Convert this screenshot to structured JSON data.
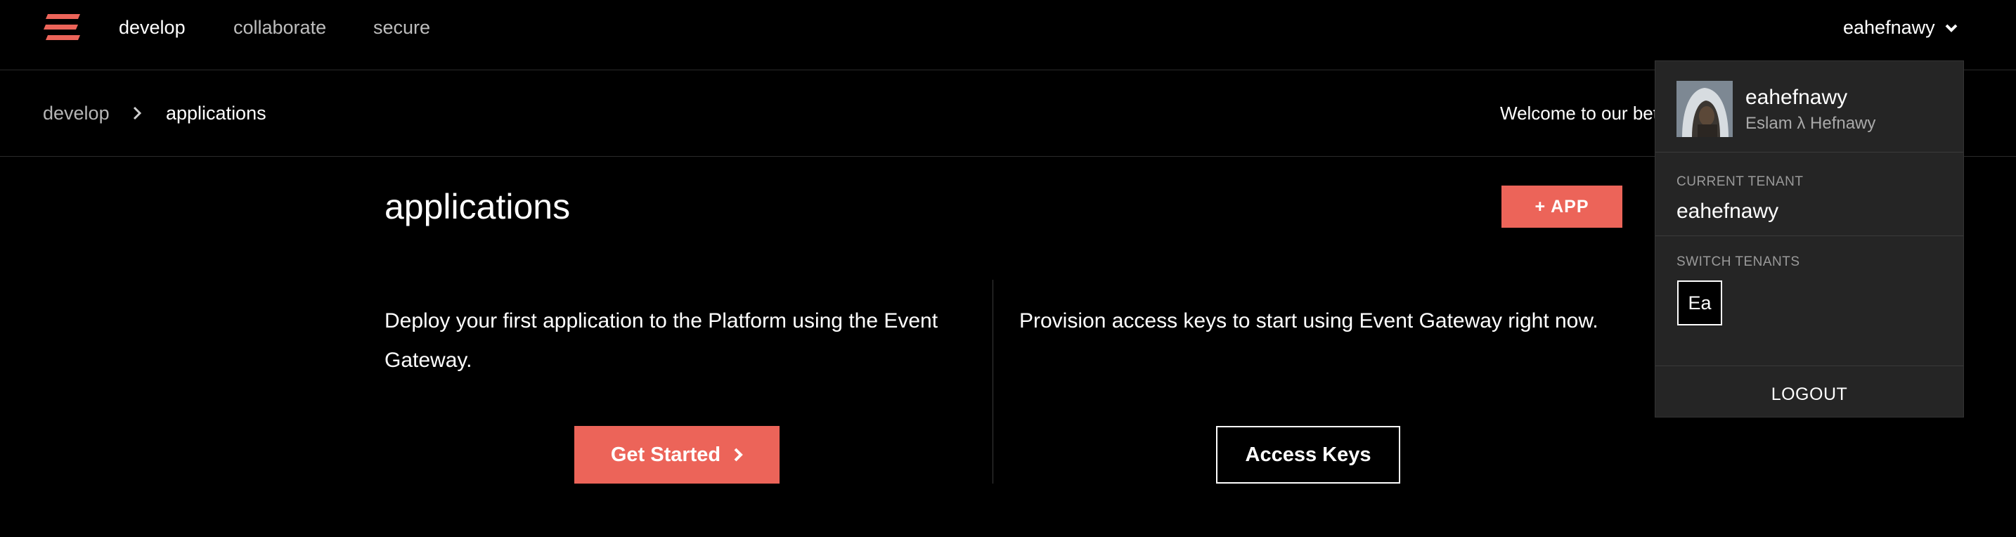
{
  "topnav": {
    "logo_icon": "serverless-logo-icon",
    "links": [
      {
        "label": "develop",
        "active": true
      },
      {
        "label": "collaborate",
        "active": false
      },
      {
        "label": "secure",
        "active": false
      }
    ],
    "user_label": "eahefnawy",
    "user_chevron_icon": "chevron-down-icon"
  },
  "subnav": {
    "breadcrumb": [
      "develop",
      "applications"
    ],
    "separator_icon": "chevron-right-icon",
    "welcome_text": "Welcome to our beta"
  },
  "main": {
    "title": "applications",
    "add_button": "+ APP",
    "left_text": "Deploy your first application to the Platform using the Event Gateway.",
    "left_button": "Get Started",
    "left_button_icon": "chevron-right-icon",
    "right_text": "Provision access keys to start using Event Gateway right now.",
    "right_button": "Access Keys"
  },
  "dropdown": {
    "username": "eahefnawy",
    "fullname": "Eslam λ Hefnawy",
    "current_tenant_label": "CURRENT TENANT",
    "current_tenant": "eahefnawy",
    "switch_tenants_label": "SWITCH TENANTS",
    "tenants": [
      "Ea"
    ],
    "logout": "LOGOUT"
  },
  "colors": {
    "background": "#000000",
    "accent": "#ec6459",
    "panel": "#252525",
    "muted_text": "#a9a9a9"
  }
}
